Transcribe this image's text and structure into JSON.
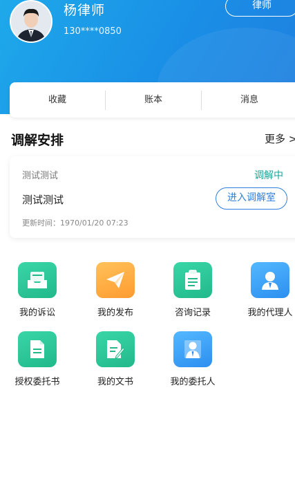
{
  "profile": {
    "name": "杨律师",
    "phone": "130****0850",
    "role_button": "律师"
  },
  "tabs": [
    {
      "label": "收藏"
    },
    {
      "label": "账本"
    },
    {
      "label": "消息"
    }
  ],
  "mediation": {
    "section_title": "调解安排",
    "more_label": "更多 >",
    "card": {
      "subtitle": "测试测试",
      "status": "调解中",
      "title": "测试测试",
      "enter_button": "进入调解室",
      "updated": "更新时间：1970/01/20 07:23"
    }
  },
  "features": [
    {
      "label": "我的诉讼",
      "icon": "inbox-icon",
      "color": "#21b98a"
    },
    {
      "label": "我的发布",
      "icon": "paper-plane-icon",
      "color": "#ff9b30"
    },
    {
      "label": "咨询记录",
      "icon": "clipboard-icon",
      "color": "#21b98a"
    },
    {
      "label": "我的代理人",
      "icon": "person-icon",
      "color": "#2c8ff0"
    },
    {
      "label": "授权委托书",
      "icon": "document-icon",
      "color": "#21b98a"
    },
    {
      "label": "我的文书",
      "icon": "document-edit-icon",
      "color": "#21b98a"
    },
    {
      "label": "我的委托人",
      "icon": "client-icon",
      "color": "#2c8ff0"
    }
  ]
}
